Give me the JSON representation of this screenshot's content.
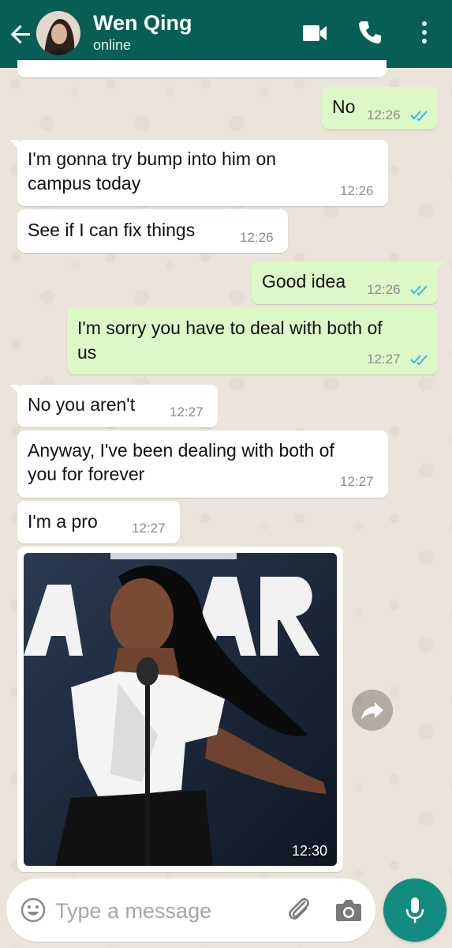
{
  "header": {
    "contact_name": "Wen Qing",
    "status": "online"
  },
  "colors": {
    "header": "#075e54",
    "incoming_bubble": "#ffffff",
    "outgoing_bubble": "#dcf8c6",
    "read_ticks": "#34b7f1",
    "mic_button": "#128c7e"
  },
  "messages": [
    {
      "direction": "out",
      "lines": [
        "No"
      ],
      "time": "12:26",
      "status": "read"
    },
    {
      "direction": "in",
      "lines": [
        "I'm gonna try bump into him on",
        "campus today"
      ],
      "time": "12:26"
    },
    {
      "direction": "in",
      "lines": [
        "See if I can fix things"
      ],
      "time": "12:26"
    },
    {
      "direction": "out",
      "lines": [
        "Good idea"
      ],
      "time": "12:26",
      "status": "read"
    },
    {
      "direction": "out",
      "lines": [
        "I'm sorry you have to deal with both of",
        "us"
      ],
      "time": "12:27",
      "status": "read"
    },
    {
      "direction": "in",
      "lines": [
        "No you aren't"
      ],
      "time": "12:27"
    },
    {
      "direction": "in",
      "lines": [
        "Anyway, I've been dealing with both of",
        "you for forever"
      ],
      "time": "12:27"
    },
    {
      "direction": "in",
      "lines": [
        "I'm a pro"
      ],
      "time": "12:27"
    }
  ],
  "photo_message": {
    "direction": "in",
    "time": "12:30"
  },
  "input": {
    "placeholder": "Type a message"
  },
  "icons": {
    "back": "arrow-left",
    "video": "video-camera",
    "call": "phone",
    "menu": "three-dots-vertical",
    "emoji": "smiley",
    "attach": "paperclip",
    "camera": "camera",
    "mic": "microphone",
    "forward": "share-arrow"
  }
}
